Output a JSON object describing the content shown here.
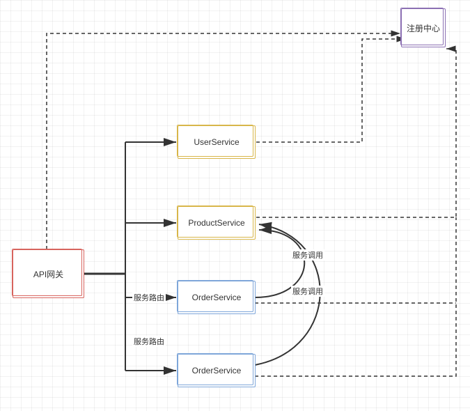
{
  "nodes": {
    "api_gateway": "API网关",
    "user_service": "UserService",
    "product_service": "ProductService",
    "order_service_1": "OrderService",
    "order_service_2": "OrderService",
    "registry": "注册中心"
  },
  "labels": {
    "route1": "服务路由",
    "route2": "服务路由",
    "call1": "服务调用",
    "call2": "服务调用"
  }
}
